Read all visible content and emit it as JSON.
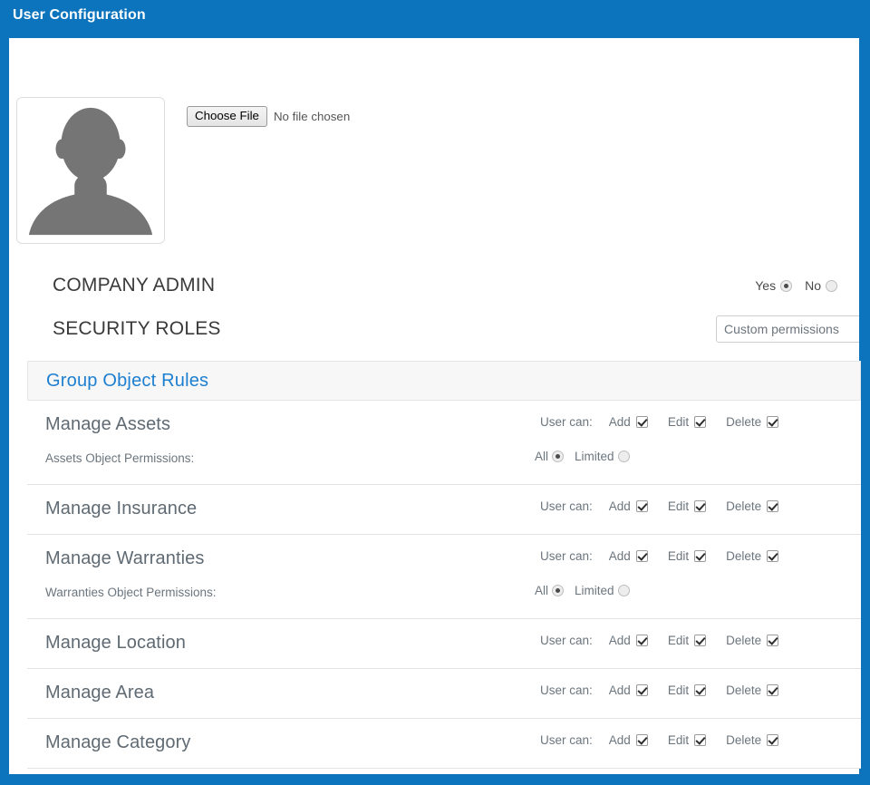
{
  "window": {
    "title": "User Configuration",
    "accent_color": "#0b74bd",
    "card_background": "#ffffff"
  },
  "avatar": {
    "icon_name": "user-silhouette-placeholder",
    "silhouette_color": "#757575"
  },
  "file_upload": {
    "button_label": "Choose File",
    "status_text": "No file chosen"
  },
  "fields": {
    "company_admin": {
      "label": "COMPANY ADMIN",
      "options": [
        {
          "label": "Yes",
          "selected": true
        },
        {
          "label": "No",
          "selected": false
        }
      ]
    },
    "security_roles": {
      "label": "SECURITY ROLES",
      "selected_value": "Custom permissions"
    }
  },
  "rules_panel": {
    "title": "Group Object Rules",
    "title_color": "#1d7fd0",
    "user_can_label": "User can:",
    "permission_labels": [
      "Add",
      "Edit",
      "Delete"
    ],
    "object_permission_options": [
      "All",
      "Limited"
    ],
    "rows": [
      {
        "title": "Manage Assets",
        "permissions": [
          {
            "label": "Add",
            "checked": true
          },
          {
            "label": "Edit",
            "checked": true
          },
          {
            "label": "Delete",
            "checked": true
          }
        ],
        "object_permissions": {
          "label": "Assets Object Permissions:",
          "options": [
            {
              "label": "All",
              "selected": true
            },
            {
              "label": "Limited",
              "selected": false
            }
          ]
        }
      },
      {
        "title": "Manage Insurance",
        "permissions": [
          {
            "label": "Add",
            "checked": true
          },
          {
            "label": "Edit",
            "checked": true
          },
          {
            "label": "Delete",
            "checked": true
          }
        ],
        "object_permissions": null
      },
      {
        "title": "Manage Warranties",
        "permissions": [
          {
            "label": "Add",
            "checked": true
          },
          {
            "label": "Edit",
            "checked": true
          },
          {
            "label": "Delete",
            "checked": true
          }
        ],
        "object_permissions": {
          "label": "Warranties Object Permissions:",
          "options": [
            {
              "label": "All",
              "selected": true
            },
            {
              "label": "Limited",
              "selected": false
            }
          ]
        }
      },
      {
        "title": "Manage Location",
        "permissions": [
          {
            "label": "Add",
            "checked": true
          },
          {
            "label": "Edit",
            "checked": true
          },
          {
            "label": "Delete",
            "checked": true
          }
        ],
        "object_permissions": null
      },
      {
        "title": "Manage Area",
        "permissions": [
          {
            "label": "Add",
            "checked": true
          },
          {
            "label": "Edit",
            "checked": true
          },
          {
            "label": "Delete",
            "checked": true
          }
        ],
        "object_permissions": null
      },
      {
        "title": "Manage Category",
        "permissions": [
          {
            "label": "Add",
            "checked": true
          },
          {
            "label": "Edit",
            "checked": true
          },
          {
            "label": "Delete",
            "checked": true
          }
        ],
        "object_permissions": null
      }
    ]
  }
}
